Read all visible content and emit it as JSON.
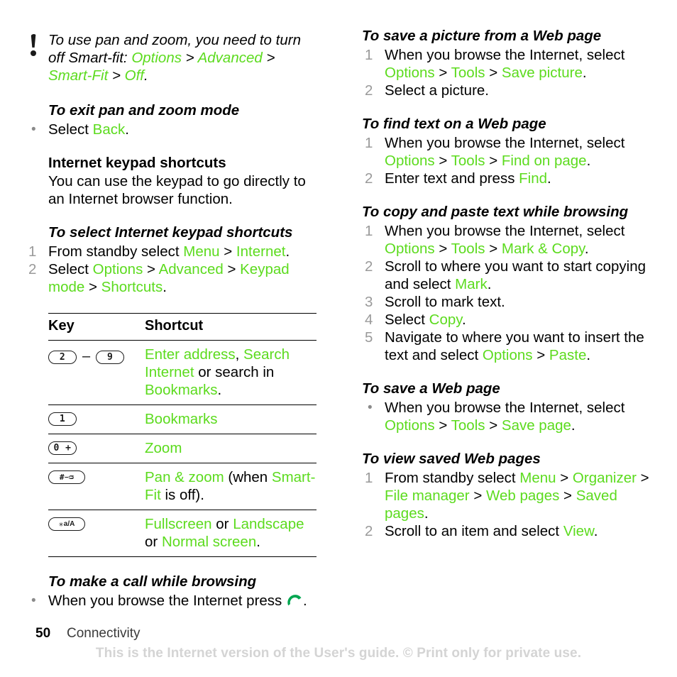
{
  "page": {
    "number": "50",
    "section": "Connectivity",
    "watermark": "This is the Internet version of the User's guide. © Print only for private use."
  },
  "icons": {
    "tip": "exclamation-mark-icon",
    "call": "call-handset-icon"
  },
  "colors": {
    "accent_green": "#5cdb1e",
    "body_text": "#000000",
    "list_number": "#9a9a9a",
    "bullet": "#8a8a8a",
    "watermark": "#d4d4d4"
  },
  "left_column": {
    "tip": {
      "parts": [
        {
          "text": "To use pan and zoom, you need to turn off Smart-fit: ",
          "style": "italic"
        },
        {
          "text": "Options",
          "style": "green-italic"
        },
        {
          "text": " > ",
          "style": "italic"
        },
        {
          "text": "Advanced",
          "style": "green-italic"
        },
        {
          "text": " > ",
          "style": "italic"
        },
        {
          "text": "Smart-Fit",
          "style": "green-italic"
        },
        {
          "text": " > ",
          "style": "italic"
        },
        {
          "text": "Off",
          "style": "green-italic"
        },
        {
          "text": ".",
          "style": "italic"
        }
      ],
      "line1": "To use pan and zoom, you need to turn",
      "line2_prefix": "off Smart-fit: ",
      "t_options": "Options",
      "t_advanced": "Advanced",
      "t_smartfit": "Smart-Fit",
      "t_off": "Off"
    },
    "exit_pan_zoom": {
      "heading": "To exit pan and zoom mode",
      "bullet_prefix": "Select ",
      "bullet_link": "Back",
      "bullet_suffix": "."
    },
    "keypad_shortcuts": {
      "heading": "Internet keypad shortcuts",
      "body": "You can use the keypad to go directly to an Internet browser function."
    },
    "select_shortcuts": {
      "heading": "To select Internet keypad shortcuts",
      "steps": [
        {
          "num": "1",
          "prefix": "From standby select ",
          "links": [
            "Menu",
            "Internet"
          ],
          "suffix": "."
        },
        {
          "num": "2",
          "prefix": "Select ",
          "links": [
            "Options",
            "Advanced",
            "Keypad mode",
            "Shortcuts"
          ],
          "suffix": "."
        }
      ]
    },
    "key_table": {
      "headers": [
        "Key",
        "Shortcut"
      ],
      "rows": [
        {
          "key_type": "range",
          "key_from": "2",
          "key_to": "9",
          "key_separator": "–",
          "shortcut_segments": [
            {
              "text": "Enter address",
              "green": true
            },
            {
              "text": ", ",
              "green": false
            },
            {
              "text": "Search Internet",
              "green": true
            },
            {
              "text": " or search in ",
              "green": false
            },
            {
              "text": "Bookmarks",
              "green": true
            },
            {
              "text": ".",
              "green": false
            }
          ]
        },
        {
          "key_type": "single",
          "key_label": "1",
          "shortcut_segments": [
            {
              "text": "Bookmarks",
              "green": true
            }
          ]
        },
        {
          "key_type": "single",
          "key_label": "0 +",
          "shortcut_segments": [
            {
              "text": "Zoom",
              "green": true
            }
          ]
        },
        {
          "key_type": "hash",
          "key_label": "#",
          "key_sub": "–ᴞ",
          "shortcut_segments": [
            {
              "text": "Pan & zoom",
              "green": true
            },
            {
              "text": " (when ",
              "green": false
            },
            {
              "text": "Smart-Fit",
              "green": true
            },
            {
              "text": " is off).",
              "green": false
            }
          ]
        },
        {
          "key_type": "star",
          "key_label": "✳",
          "key_sub": "a/A",
          "shortcut_segments": [
            {
              "text": "Fullscreen",
              "green": true
            },
            {
              "text": " or ",
              "green": false
            },
            {
              "text": "Landscape",
              "green": true
            },
            {
              "text": " or ",
              "green": false
            },
            {
              "text": "Normal screen",
              "green": true
            },
            {
              "text": ".",
              "green": false
            }
          ]
        }
      ]
    },
    "make_call": {
      "heading": "To make a call while browsing",
      "bullet_prefix": "When you browse the Internet press ",
      "bullet_suffix": "."
    }
  },
  "right_column": {
    "save_picture": {
      "heading": "To save a picture from a Web page",
      "steps": [
        {
          "num": "1",
          "prefix": "When you browse the Internet, select ",
          "links": [
            "Options",
            "Tools",
            "Save picture"
          ],
          "suffix": "."
        },
        {
          "num": "2",
          "prefix": "Select a picture.",
          "links": [],
          "suffix": ""
        }
      ]
    },
    "find_text": {
      "heading": "To find text on a Web page",
      "steps": [
        {
          "num": "1",
          "prefix": "When you browse the Internet, select ",
          "links": [
            "Options",
            "Tools",
            "Find on page"
          ],
          "suffix": "."
        },
        {
          "num": "2",
          "prefix": "Enter text and press ",
          "links": [
            "Find"
          ],
          "suffix": "."
        }
      ]
    },
    "copy_paste": {
      "heading": "To copy and paste text while browsing",
      "steps": [
        {
          "num": "1",
          "prefix": "When you browse the Internet, select ",
          "links": [
            "Options",
            "Tools",
            "Mark & Copy"
          ],
          "suffix": "."
        },
        {
          "num": "2",
          "prefix": "Scroll to where you want to start copying and select ",
          "links": [
            "Mark"
          ],
          "suffix": "."
        },
        {
          "num": "3",
          "prefix": "Scroll to mark text.",
          "links": [],
          "suffix": ""
        },
        {
          "num": "4",
          "prefix": "Select ",
          "links": [
            "Copy"
          ],
          "suffix": "."
        },
        {
          "num": "5",
          "prefix": "Navigate to where you want to insert the text and select ",
          "links": [
            "Options",
            "Paste"
          ],
          "suffix": "."
        }
      ]
    },
    "save_page": {
      "heading": "To save a Web page",
      "bullet": {
        "prefix": "When you browse the Internet, select ",
        "links": [
          "Options",
          "Tools",
          "Save page"
        ],
        "suffix": "."
      }
    },
    "view_saved": {
      "heading": "To view saved Web pages",
      "steps": [
        {
          "num": "1",
          "prefix": "From standby select ",
          "links": [
            "Menu",
            "Organizer",
            "File manager",
            "Web pages",
            "Saved pages"
          ],
          "suffix": "."
        },
        {
          "num": "2",
          "prefix": "Scroll to an item and select ",
          "links": [
            "View"
          ],
          "suffix": "."
        }
      ]
    }
  }
}
